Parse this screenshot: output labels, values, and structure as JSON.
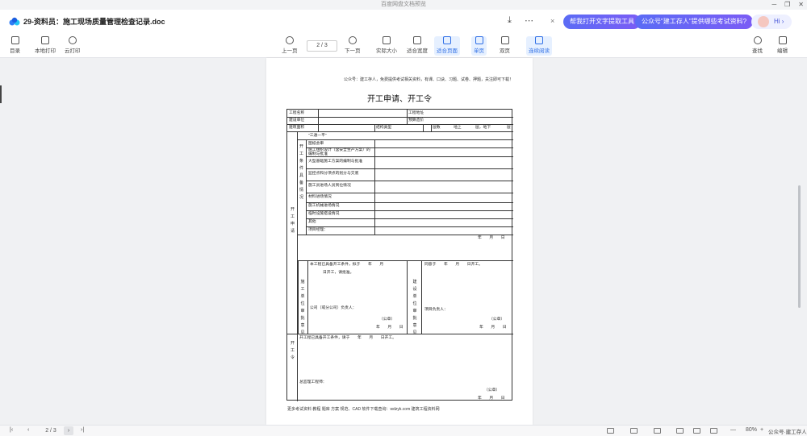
{
  "window": {
    "title": "百度网盘文档预览",
    "minimize": "─",
    "restore": "❐",
    "close": "✕"
  },
  "header": {
    "doc_title": "29-资料员：施工现场质量管理检查记录.doc",
    "download_icon": "⤓",
    "share_icon": "⋯",
    "close_promo": "×",
    "pill_extract": "帮我打开文字提取工具",
    "pill_ask": "公众号\"建工存人\"提供哪些考试资料?",
    "ai_greet": "Hi ›"
  },
  "toolbar": {
    "outline": "目录",
    "local_print": "本地打印",
    "cloud_print": "云打印",
    "prev_page": "上一页",
    "page_indicator": "2 / 3",
    "next_page": "下一页",
    "actual_size": "实际大小",
    "fit_width": "适合宽度",
    "fit_page": "适合页面",
    "single_page": "单页",
    "double_page": "双页",
    "continuous": "连续阅读",
    "find": "查找",
    "edit": "编辑"
  },
  "doc": {
    "note_top": "公众号：建工存人，免费提供考试相关资料，有课、口诀、习题、试卷、押题，关注即可下载！",
    "heading": "开工申请、开工令",
    "project_name": "工程名称",
    "project_location": "工程地址",
    "construction_unit": "建设单位",
    "budget": "预算造价",
    "building_area": "建筑面积",
    "structure_type": "结构类型",
    "floors": "层数",
    "above": "地上",
    "floors_unit_1": "层，地下",
    "floors_unit_2": "层",
    "three_one": "\"三通一平\"",
    "drawing_review": "图纸会审",
    "org_design": "施工组织设计（含安全生产方案）的编制与批准",
    "major_plan": "大型基础施工方案的编制与批准",
    "quality_plan": "监控点和分项点的划分与交底",
    "personnel": "施工员进场人员到位情况",
    "material_entry": "材料进场情况",
    "equipment": "施工机械进场情况",
    "temp_facilities": "临时设施搭设情况",
    "other": "其他",
    "pm_sign": "项目经理：",
    "ymd": "年　　月　　日",
    "left_v1": "开工申请",
    "left_v2": "开工条件具备情况",
    "apply_text_1": "本工程已具备开工条件，拟于　　年　　月",
    "apply_text_2": "日开工，请批准。",
    "construction_opinion": "施工单位审批意见",
    "company_sign": "公司（或分公司）负责人：",
    "seal": "（公章）",
    "owner_agree": "同意于　　年　　月　　日开工。",
    "owner_opinion": "建设单位审批意见",
    "project_lead": "项目负责人：",
    "order_v": "开工令",
    "order_text": "开工程已具备开工条件，请于　　年　　月　　日开工。",
    "chief_engineer": "总监理工程师：",
    "note_bottom": "更多考试资料 教程 题库 方案 规范、CAD 软件下载查询：wdzyk.com 建筑工程资料网"
  },
  "statusbar": {
    "first": "|‹",
    "prev": "‹",
    "page": "2 / 3",
    "next": "›",
    "last": "›|",
    "zoom_minus": "—",
    "zoom": "80%",
    "zoom_plus": "+",
    "watermark": "公众号·建工存人"
  }
}
